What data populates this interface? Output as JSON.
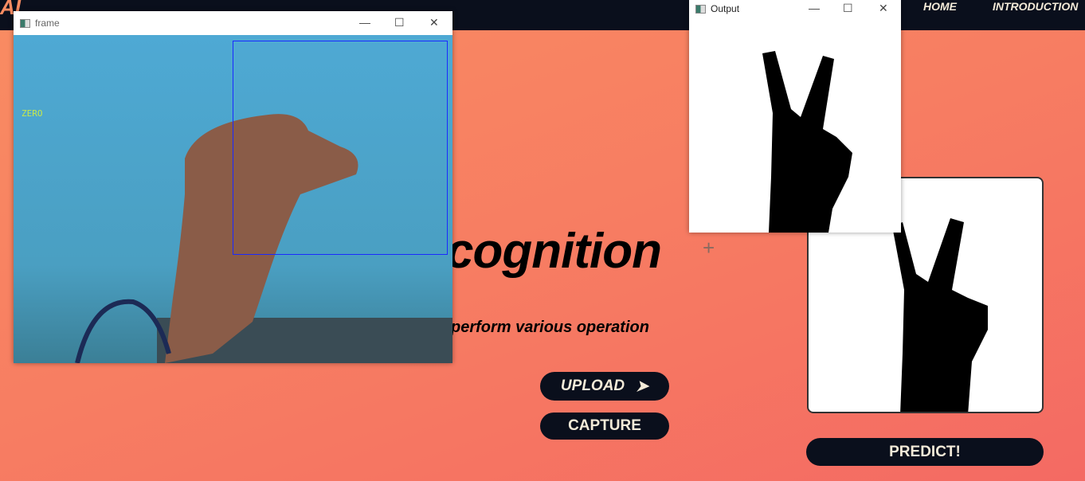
{
  "site": {
    "logo": "AI",
    "nav": [
      {
        "label": "HOME"
      },
      {
        "label": "INTRODUCTION"
      }
    ]
  },
  "main": {
    "heading": "cognition",
    "subtitle": "perform various operation",
    "upload_label": "UPLOAD",
    "capture_label": "CAPTURE",
    "predict_label": "PREDICT!"
  },
  "frame_window": {
    "title": "frame",
    "overlay_text": "ZERO",
    "roi_color": "#1a2aff",
    "overlay_color": "#c8e84a"
  },
  "output_window": {
    "title": "Output"
  },
  "colors": {
    "nav_bg": "#0a0f1c",
    "button_bg": "#0a0f1c",
    "button_text": "#f3ead8",
    "bg_start": "#f98c62",
    "bg_end": "#f46a63"
  }
}
